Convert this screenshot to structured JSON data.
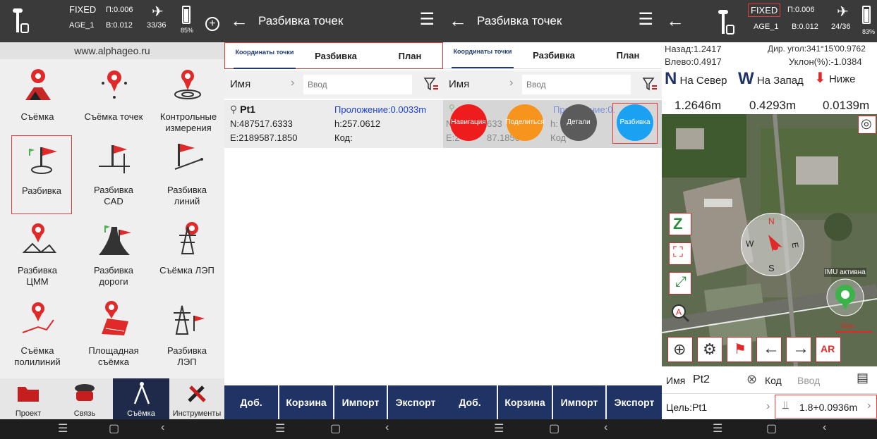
{
  "panel1": {
    "status": {
      "fix": "FIXED",
      "p": "П:0.006",
      "age": "AGE_1",
      "b": "B:0.012",
      "sats": "33/36",
      "battery": "85%"
    },
    "url": "www.alphageo.ru",
    "tiles": [
      {
        "label": "Съёмка",
        "icon": "survey-icon"
      },
      {
        "label": "Съёмка точек",
        "icon": "point-survey-icon"
      },
      {
        "label": "Контрольные измерения",
        "icon": "control-measure-icon"
      },
      {
        "label": "Разбивка",
        "icon": "stakeout-icon"
      },
      {
        "label": "Разбивка CAD",
        "icon": "stakeout-cad-icon"
      },
      {
        "label": "Разбивка линий",
        "icon": "stakeout-lines-icon"
      },
      {
        "label": "Разбивка ЦММ",
        "icon": "stakeout-dtm-icon"
      },
      {
        "label": "Разбивка дороги",
        "icon": "stakeout-road-icon"
      },
      {
        "label": "Съёмка ЛЭП",
        "icon": "powerline-survey-icon"
      },
      {
        "label": "Съёмка полилиний",
        "icon": "polyline-survey-icon"
      },
      {
        "label": "Площадная съёмка",
        "icon": "area-survey-icon"
      },
      {
        "label": "Разбивка ЛЭП",
        "icon": "powerline-stakeout-icon"
      }
    ],
    "bottom_tabs": [
      "Проект",
      "Связь",
      "Съёмка",
      "Инструменты"
    ]
  },
  "list": {
    "title": "Разбивка точек",
    "tabs": [
      "Координаты точки",
      "Разбивка",
      "План"
    ],
    "search_label": "Имя",
    "search_placeholder": "Ввод",
    "point": {
      "name": "Pt1",
      "n": "N:487517.6333",
      "e": "E:2189587.1850",
      "dist": "Проложение:0.0033m",
      "h": "h:257.0612",
      "code": "Код:"
    },
    "actions": [
      "Доб.",
      "Корзина",
      "Импорт",
      "Экспорт"
    ],
    "bubbles": [
      "Навигация",
      "Поделиться",
      "Детали",
      "Разбивка"
    ],
    "p3_row": {
      "n": "N",
      "n_frag": "633",
      "e_frag": "E:2",
      "e_frag2": "87.1850",
      "h_frag": "h:",
      "code_frag": "Код",
      "dist_frag1": "Про",
      "dist_frag2": "ние:0."
    }
  },
  "panel4": {
    "status": {
      "fix": "FIXED",
      "p": "П:0.006",
      "age": "AGE_1",
      "b": "B:0.012",
      "sats": "24/36",
      "battery": "83%"
    },
    "back": "Назад:1.2417",
    "left": "Влево:0.4917",
    "azimuth": "Дир. угол:341°15'00.9762",
    "slope": "Уклон(%):-1.0384",
    "north": {
      "letter": "N",
      "label": "На Север",
      "value": "1.2646m"
    },
    "west": {
      "letter": "W",
      "label": "На Запад",
      "value": "0.4293m"
    },
    "down": {
      "label": "Ниже",
      "value": "0.0139m"
    },
    "imu": "IMU активна",
    "scale": "50m",
    "name_label": "Имя",
    "name_value": "Pt2",
    "code_label": "Код",
    "code_placeholder": "Ввод",
    "target": "Цель:Pt1",
    "pole": "1.8+0.0936m",
    "compass": {
      "n": "N",
      "e": "E",
      "s": "S",
      "w": "W"
    }
  },
  "colors": {
    "accent": "#1f3364",
    "red": "#e02a2a",
    "blue_text": "#1a3fd8",
    "status_bg": "#3a3a3a"
  }
}
